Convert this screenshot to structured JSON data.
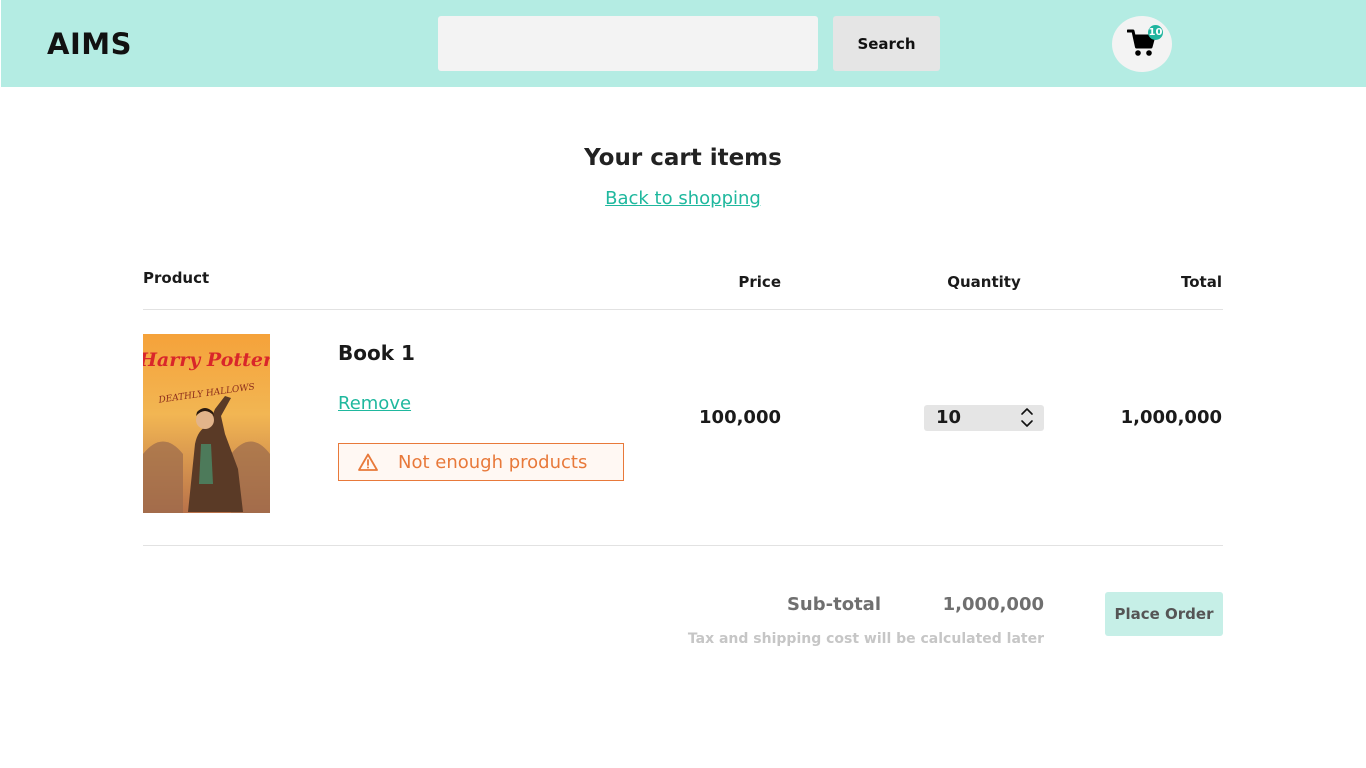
{
  "header": {
    "logo": "AIMS",
    "search": {
      "value": "",
      "placeholder": ""
    },
    "search_button": "Search",
    "cart_icon": "shopping-cart-icon",
    "cart_count": "10",
    "colors": {
      "header_bg": "#b4ece3",
      "badge": "#22b59f"
    }
  },
  "page": {
    "title": "Your cart items",
    "back_link": "Back to shopping"
  },
  "table": {
    "columns": [
      "Product",
      "Price",
      "Quantity",
      "Total"
    ],
    "rows": [
      {
        "cover_title": "Harry Potter",
        "cover_subtitle": "DEATHLY HALLOWS",
        "name": "Book 1",
        "remove_label": "Remove",
        "warning_icon": "warning-triangle-icon",
        "warning": "Not enough products",
        "price": "100,000",
        "quantity": "10",
        "total": "1,000,000"
      }
    ]
  },
  "summary": {
    "subtotal_label": "Sub-total",
    "subtotal_value": "1,000,000",
    "tax_note": "Tax and shipping cost will be calculated later",
    "place_order": "Place Order"
  },
  "colors": {
    "accent": "#1fb89e",
    "warning": "#e8793a"
  }
}
